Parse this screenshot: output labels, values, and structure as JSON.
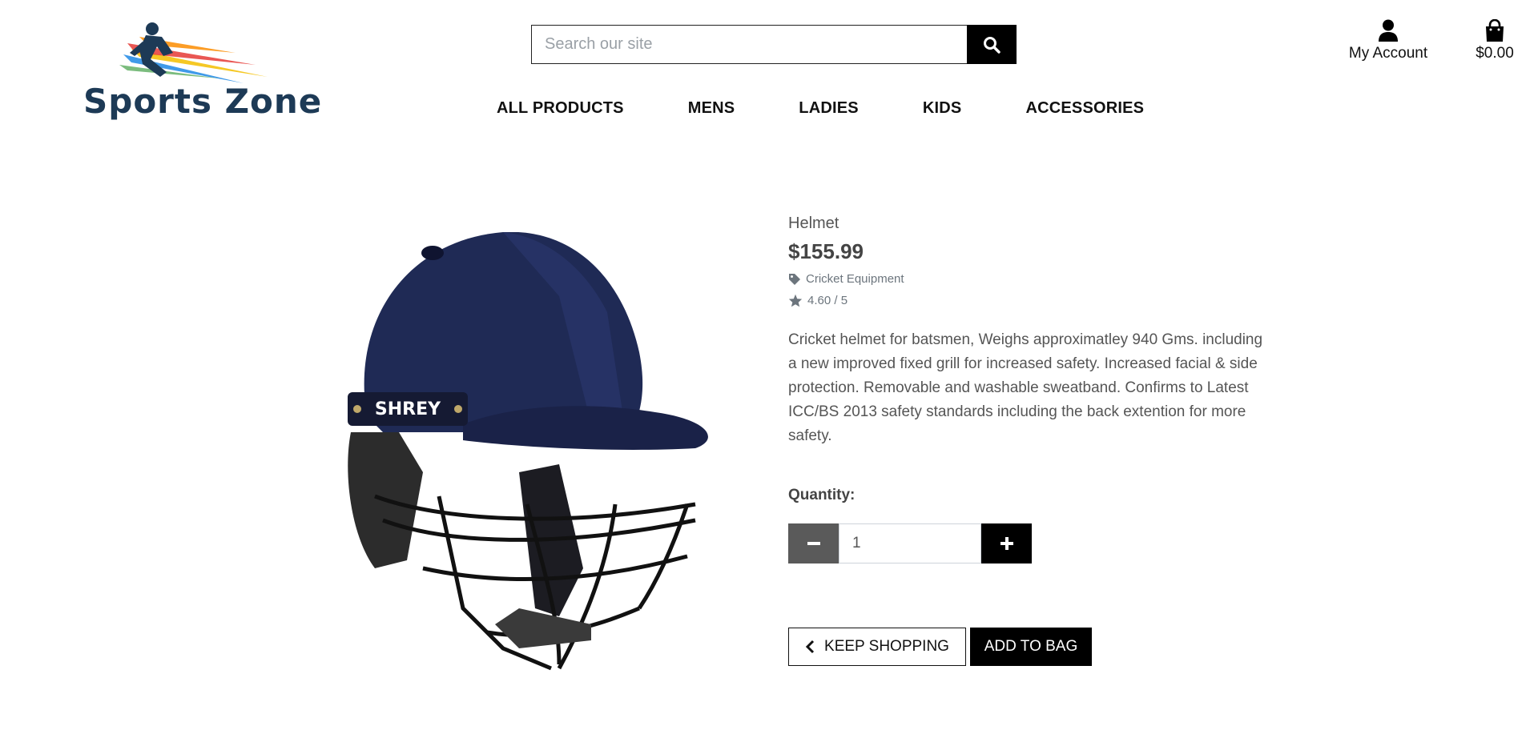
{
  "brand": {
    "name": "Sports Zone",
    "logo_icon": "running-athlete-logo"
  },
  "search": {
    "placeholder": "Search our site",
    "icon": "search-icon"
  },
  "header": {
    "account_label": "My Account",
    "account_icon": "user-icon",
    "bag_total": "$0.00",
    "bag_icon": "shopping-bag-icon"
  },
  "nav": {
    "items": [
      {
        "label": "ALL PRODUCTS"
      },
      {
        "label": "MENS"
      },
      {
        "label": "LADIES"
      },
      {
        "label": "KIDS"
      },
      {
        "label": "ACCESSORIES"
      }
    ]
  },
  "product": {
    "name": "Helmet",
    "price": "$155.99",
    "category": "Cricket Equipment",
    "category_icon": "tag-icon",
    "rating": "4.60 / 5",
    "rating_icon": "star-icon",
    "description": "Cricket helmet for batsmen, Weighs approximatley 940 Gms. including a new improved fixed grill for increased safety. Increased facial & side protection. Removable and washable sweatband. Confirms to Latest ICC/BS 2013 safety standards including the back extention for more safety.",
    "image_brand_text": "SHREY"
  },
  "quantity": {
    "label": "Quantity:",
    "value": "1"
  },
  "actions": {
    "keep_shopping": "KEEP SHOPPING",
    "add_to_bag": "ADD TO BAG"
  },
  "colors": {
    "brand_navy": "#1d3a56",
    "helmet_navy": "#1f2a55",
    "black": "#000000",
    "minus_gray": "#5a5a5a"
  }
}
